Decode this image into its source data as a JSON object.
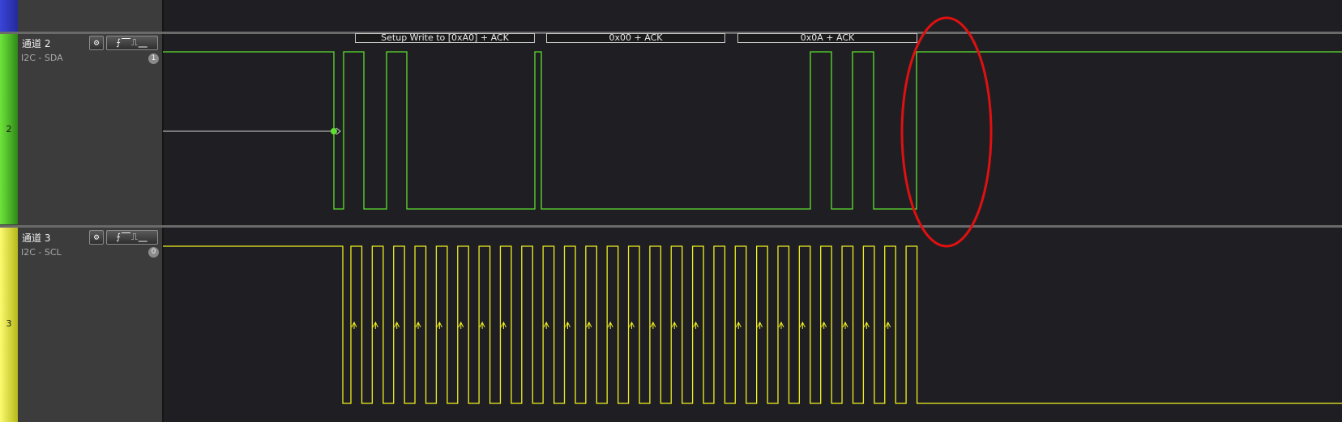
{
  "channels": [
    {
      "index": "2",
      "name": "通道 2",
      "protocol_label": "I2C - SDA",
      "badge": "1",
      "color": "#6ee43a"
    },
    {
      "index": "3",
      "name": "通道 3",
      "protocol_label": "I2C - SCL",
      "badge": "0",
      "color": "#f2f25a"
    }
  ],
  "toolbar": {
    "gear_glyph": "⚙",
    "edge_glyphs": "⨍⎺⎍⎽"
  },
  "decoder_frames": [
    {
      "label": "Setup Write to [0xA0] + ACK"
    },
    {
      "label": "0x00 + ACK"
    },
    {
      "label": "0x0A + ACK"
    }
  ],
  "colors": {
    "background": "#1f1f23",
    "sda_wave": "#5fe030",
    "scl_wave": "#f0f020",
    "annotation_circle": "#e01010"
  }
}
